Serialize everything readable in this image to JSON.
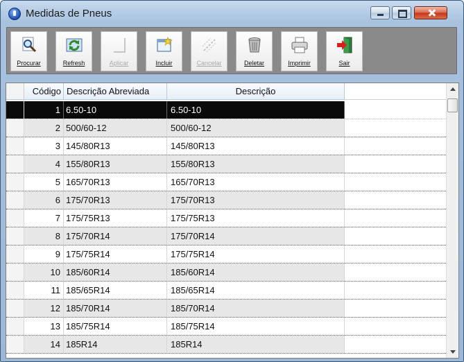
{
  "window": {
    "title": "Medidas de Pneus"
  },
  "toolbar": {
    "buttons": [
      {
        "label": "Procurar",
        "enabled": true
      },
      {
        "label": "Refresh",
        "enabled": true
      },
      {
        "label": "Aplicar",
        "enabled": false
      },
      {
        "label": "Incluir",
        "enabled": true
      },
      {
        "label": "Cancelar",
        "enabled": false
      },
      {
        "label": "Deletar",
        "enabled": true
      },
      {
        "label": "Imprimir",
        "enabled": true
      },
      {
        "label": "Sair",
        "enabled": true
      }
    ]
  },
  "grid": {
    "columns": [
      "Código",
      "Descrição Abreviada",
      "Descrição"
    ],
    "selected_row": 0,
    "rows": [
      {
        "codigo": "1",
        "abreviada": "6.50-10",
        "descricao": "6.50-10"
      },
      {
        "codigo": "2",
        "abreviada": "500/60-12",
        "descricao": "500/60-12"
      },
      {
        "codigo": "3",
        "abreviada": "145/80R13",
        "descricao": "145/80R13"
      },
      {
        "codigo": "4",
        "abreviada": "155/80R13",
        "descricao": "155/80R13"
      },
      {
        "codigo": "5",
        "abreviada": "165/70R13",
        "descricao": "165/70R13"
      },
      {
        "codigo": "6",
        "abreviada": "175/70R13",
        "descricao": "175/70R13"
      },
      {
        "codigo": "7",
        "abreviada": "175/75R13",
        "descricao": "175/75R13"
      },
      {
        "codigo": "8",
        "abreviada": "175/70R14",
        "descricao": "175/70R14"
      },
      {
        "codigo": "9",
        "abreviada": "175/75R14",
        "descricao": "175/75R14"
      },
      {
        "codigo": "10",
        "abreviada": "185/60R14",
        "descricao": "185/60R14"
      },
      {
        "codigo": "11",
        "abreviada": "185/65R14",
        "descricao": "185/65R14"
      },
      {
        "codigo": "12",
        "abreviada": "185/70R14",
        "descricao": "185/70R14"
      },
      {
        "codigo": "13",
        "abreviada": "185/75R14",
        "descricao": "185/75R14"
      },
      {
        "codigo": "14",
        "abreviada": "185R14",
        "descricao": "185R14"
      }
    ]
  }
}
